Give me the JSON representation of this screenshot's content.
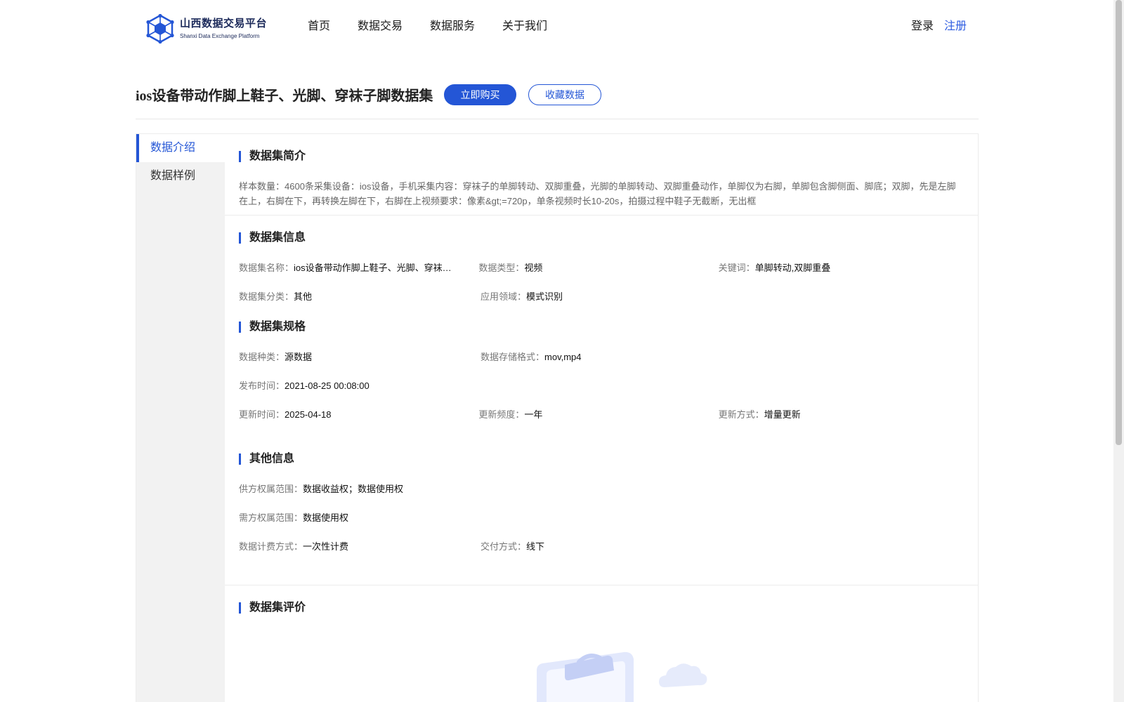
{
  "header": {
    "logo": {
      "cn": "山西数据交易平台",
      "en": "Shanxi Data Exchange Platform"
    },
    "nav": [
      {
        "label": "首页"
      },
      {
        "label": "数据交易"
      },
      {
        "label": "数据服务"
      },
      {
        "label": "关于我们"
      }
    ],
    "auth": {
      "login": "登录",
      "register": "注册"
    }
  },
  "title_bar": {
    "title": "ios设备带动作脚上鞋子、光脚、穿袜子脚数据集",
    "buy_label": "立即购买",
    "favorite_label": "收藏数据"
  },
  "sidebar": {
    "items": [
      {
        "label": "数据介绍",
        "active": true
      },
      {
        "label": "数据样例",
        "active": false
      }
    ]
  },
  "intro": {
    "heading": "数据集简介",
    "text": "样本数量：4600条采集设备：ios设备，手机采集内容：穿袜子的单脚转动、双脚重叠，光脚的单脚转动、双脚重叠动作，单脚仅为右脚，单脚包含脚侧面、脚底；双脚，先是左脚在上，右脚在下，再转换左脚在下，右脚在上视频要求：像素&gt;=720p，单条视频时长10-20s，拍摄过程中鞋子无截断，无出框"
  },
  "info": {
    "heading": "数据集信息",
    "name": {
      "key": "数据集名称：",
      "value": "ios设备带动作脚上鞋子、光脚、穿袜子脚数据集"
    },
    "type": {
      "key": "数据类型：",
      "value": "视频"
    },
    "keywords": {
      "key": "关键词：",
      "value": "单脚转动,双脚重叠"
    },
    "category": {
      "key": "数据集分类：",
      "value": "其他"
    },
    "domain": {
      "key": "应用领域：",
      "value": "模式识别"
    }
  },
  "spec": {
    "heading": "数据集规格",
    "kind": {
      "key": "数据种类：",
      "value": "源数据"
    },
    "format": {
      "key": "数据存储格式：",
      "value": "mov,mp4"
    },
    "publish_time": {
      "key": "发布时间：",
      "value": "2021-08-25 00:08:00"
    },
    "update_time": {
      "key": "更新时间：",
      "value": "2025-04-18"
    },
    "update_freq": {
      "key": "更新频度：",
      "value": "一年"
    },
    "update_mode": {
      "key": "更新方式：",
      "value": "增量更新"
    }
  },
  "other": {
    "heading": "其他信息",
    "supply_rights": {
      "key": "供方权属范围：",
      "value": "数据收益权；数据使用权"
    },
    "demand_rights": {
      "key": "需方权属范围：",
      "value": "数据使用权"
    },
    "billing": {
      "key": "数据计费方式：",
      "value": "一次性计费"
    },
    "delivery": {
      "key": "交付方式：",
      "value": "线下"
    }
  },
  "evaluation": {
    "heading": "数据集评价",
    "empty_icon": "empty-clipboard-icon"
  },
  "colors": {
    "accent": "#2456d6",
    "logo_text": "#1c2a5a",
    "sidebar_bg": "#f2f2f2"
  }
}
